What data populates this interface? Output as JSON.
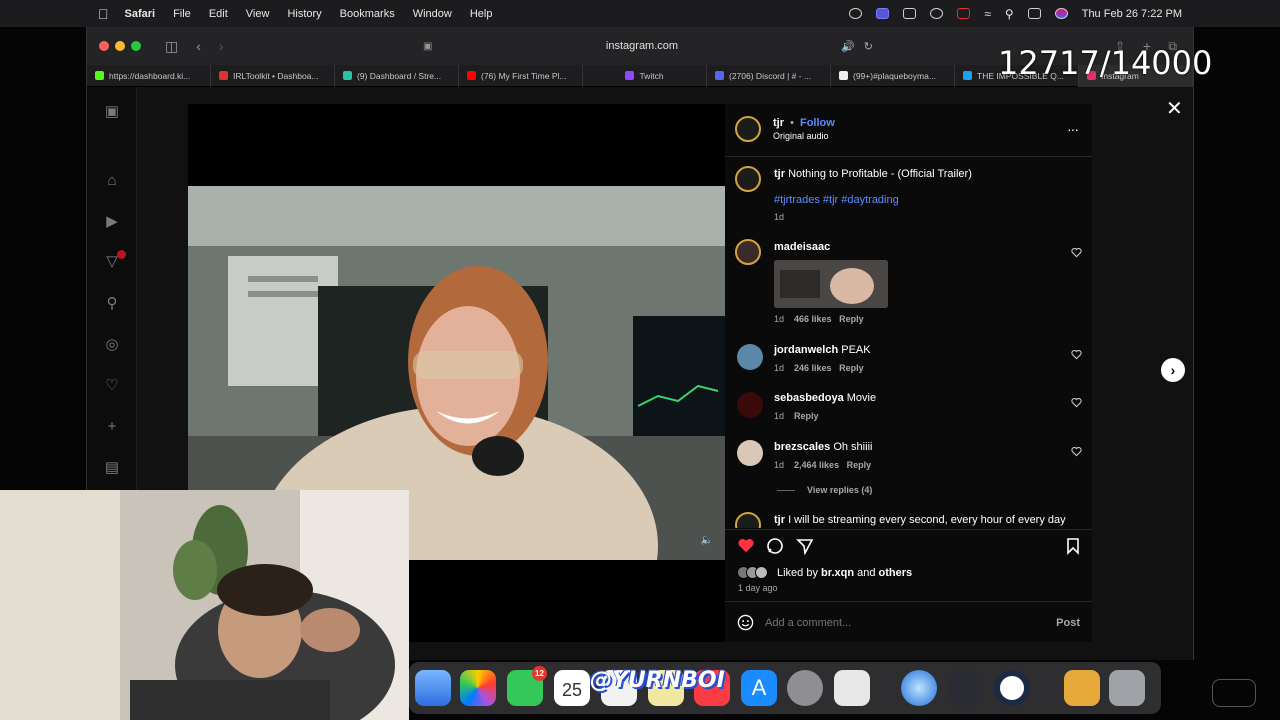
{
  "menubar": {
    "app": "Safari",
    "items": [
      "File",
      "Edit",
      "View",
      "History",
      "Bookmarks",
      "Window",
      "Help"
    ],
    "clock": "Thu Feb 26  7:22 PM"
  },
  "browser": {
    "url": "instagram.com",
    "tabs": [
      {
        "label": "https://dashboard.ki...",
        "color": "#53fc18"
      },
      {
        "label": "IRLToolkit • Dashboa...",
        "color": "#e03131"
      },
      {
        "label": "(9) Dashboard / Stre...",
        "color": "#22c3a6"
      },
      {
        "label": "(76) My First Time Pl...",
        "color": "#ff0000"
      },
      {
        "label": "Twitch",
        "color": "#9146ff"
      },
      {
        "label": "(2706) Discord | # - ...",
        "color": "#5865f2"
      },
      {
        "label": "(99+)#plaqueboyma...",
        "color": "#eeeeee"
      },
      {
        "label": "THE IMPOSSIBLE Q...",
        "color": "#1da1f2"
      },
      {
        "label": "Instagram",
        "color": "#e1306c"
      }
    ]
  },
  "overlay": {
    "counter": "12717/14000",
    "watermark": "@YURNBOI"
  },
  "post": {
    "author": "tjr",
    "follow": "Follow",
    "dot": "•",
    "audio": "Original audio",
    "caption_user": "tjr",
    "caption": "Nothing to Profitable - (Official Trailer)",
    "hashtags": "#tjrtrades #tjr #daytrading",
    "caption_age": "1d",
    "comments": [
      {
        "user": "madeisaac",
        "text": "",
        "age": "1d",
        "likes": "466 likes",
        "reply": "Reply",
        "has_image": true
      },
      {
        "user": "jordanwelch",
        "text": "PEAK",
        "age": "1d",
        "likes": "246 likes",
        "reply": "Reply"
      },
      {
        "user": "sebasbedoya",
        "text": "Movie",
        "age": "1d",
        "likes": "",
        "reply": "Reply"
      },
      {
        "user": "brezscales",
        "text": "Oh shiiii",
        "age": "1d",
        "likes": "2,464 likes",
        "reply": "Reply"
      }
    ],
    "view_replies": "View replies (4)",
    "last_comment_user": "tjr",
    "last_comment": "I will be streaming every second, every hour of every day",
    "liked_by_prefix": "Liked by",
    "liked_by_user": "br.xqn",
    "liked_by_and": "and",
    "liked_by_others": "others",
    "post_age": "1 day ago",
    "add_comment_placeholder": "Add a comment...",
    "post_button": "Post"
  },
  "dock": {
    "facetime_badge": "12",
    "calendar_day": "25"
  }
}
